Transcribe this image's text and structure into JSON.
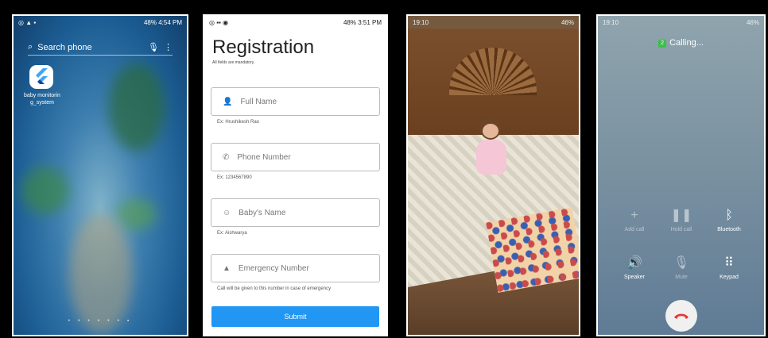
{
  "phone1": {
    "status_time": "48% 4:54 PM",
    "search_placeholder": "Search phone",
    "app_label": "baby monitorin g_system"
  },
  "phone2": {
    "status_time": "48% 3:51 PM",
    "title": "Registration",
    "subtitle": "All fields are mandatory.",
    "fields": [
      {
        "label": "Full Name",
        "hint": "Ex: Hrushikesh Rao"
      },
      {
        "label": "Phone Number",
        "hint": "Ex: 1234567890"
      },
      {
        "label": "Baby's Name",
        "hint": "Ex: Aishwarya"
      },
      {
        "label": "Emergency Number",
        "hint": "Call will be given to this number in case of emergency"
      }
    ],
    "submit_label": "Submit"
  },
  "phone3": {
    "status_time": "19:10",
    "status_right": "46%"
  },
  "phone4": {
    "status_time": "19:10",
    "status_right": "46%",
    "sim_badge": "2",
    "calling_text": "Calling...",
    "controls": [
      {
        "label": "Add call"
      },
      {
        "label": "Hold call"
      },
      {
        "label": "Bluetooth"
      },
      {
        "label": "Speaker"
      },
      {
        "label": "Mute"
      },
      {
        "label": "Keypad"
      }
    ]
  },
  "colors": {
    "submit_blue": "#2196f3",
    "end_call_red": "#e53935"
  }
}
